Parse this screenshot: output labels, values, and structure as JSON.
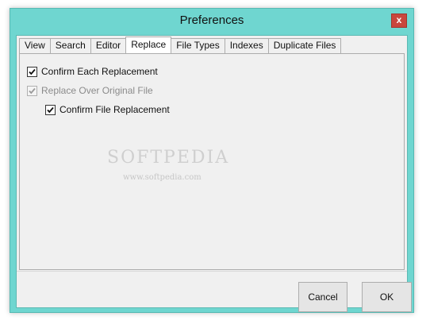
{
  "window": {
    "title": "Preferences",
    "close_glyph": "x"
  },
  "tabs": [
    {
      "label": "View"
    },
    {
      "label": "Search"
    },
    {
      "label": "Editor"
    },
    {
      "label": "Replace"
    },
    {
      "label": "File Types"
    },
    {
      "label": "Indexes"
    },
    {
      "label": "Duplicate Files"
    }
  ],
  "active_tab": "Replace",
  "options": {
    "confirm_each_replacement": {
      "label": "Confirm Each Replacement",
      "checked": true,
      "enabled": true
    },
    "replace_over_original": {
      "label": "Replace Over Original File",
      "checked": true,
      "enabled": false
    },
    "confirm_file_replacement": {
      "label": "Confirm File Replacement",
      "checked": true,
      "enabled": true
    }
  },
  "watermark": {
    "text": "SOFTPEDIA",
    "sub": "www.softpedia.com"
  },
  "buttons": {
    "cancel": "Cancel",
    "ok": "OK"
  }
}
